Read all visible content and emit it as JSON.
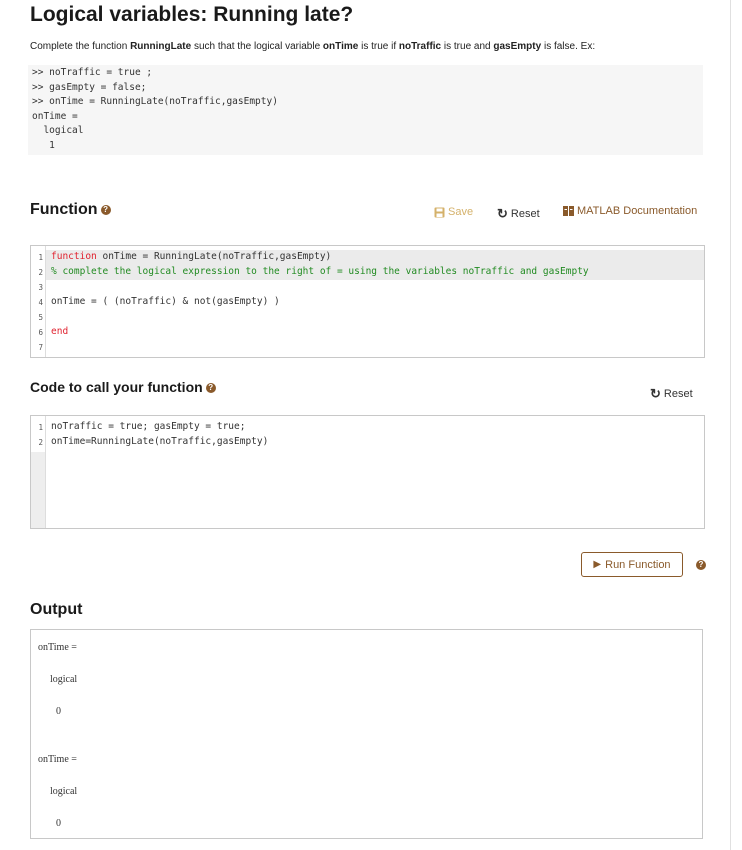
{
  "title": "Logical variables: Running late?",
  "description": {
    "parts": [
      "Complete the function ",
      "RunningLate",
      " such that the logical variable ",
      "onTime",
      " is true if ",
      "noTraffic",
      " is true and ",
      "gasEmpty",
      " is false.  Ex:"
    ]
  },
  "example_code": ">> noTraffic = true ;\n>> gasEmpty = false;\n>> onTime = RunningLate(noTraffic,gasEmpty)\nonTime =\n  logical\n   1",
  "function_section": {
    "heading": "Function",
    "save_label": "Save",
    "reset_label": "Reset",
    "docs_label": "MATLAB Documentation",
    "lines": [
      {
        "num": "1",
        "kw": "function",
        "text": " onTime = RunningLate(noTraffic,gasEmpty)"
      },
      {
        "num": "2",
        "comment": "% complete the logical expression to the right of = using the variables noTraffic and gasEmpty"
      },
      {
        "num": "3",
        "text": ""
      },
      {
        "num": "4",
        "text": "onTime = ( (noTraffic) & not(gasEmpty) )"
      },
      {
        "num": "5",
        "text": ""
      },
      {
        "num": "6",
        "kw": "end"
      },
      {
        "num": "7",
        "text": ""
      }
    ]
  },
  "call_section": {
    "heading": "Code to call your function",
    "reset_label": "Reset",
    "lines": [
      {
        "num": "1",
        "text": "noTraffic = true; gasEmpty = true;"
      },
      {
        "num": "2",
        "text": "onTime=RunningLate(noTraffic,gasEmpty)"
      }
    ]
  },
  "run_label": "Run Function",
  "output": {
    "heading": "Output",
    "lines": [
      "onTime =",
      "logical",
      "0",
      "onTime =",
      "logical",
      "0"
    ]
  },
  "colors": {
    "accent": "#8a5a2b",
    "save_disabled": "#d4b16a",
    "keyword": "#e0222f",
    "comment": "#228b22"
  }
}
